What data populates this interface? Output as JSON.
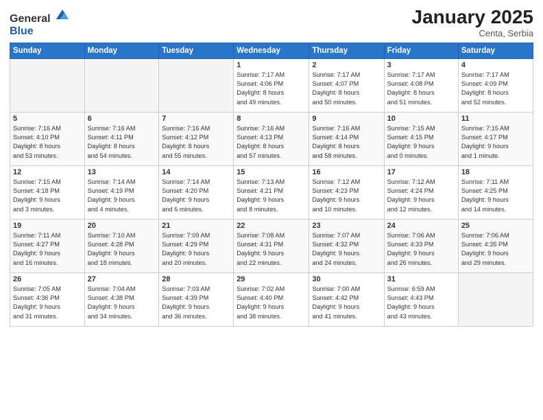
{
  "header": {
    "logo_general": "General",
    "logo_blue": "Blue",
    "month_year": "January 2025",
    "location": "Centa, Serbia"
  },
  "days_of_week": [
    "Sunday",
    "Monday",
    "Tuesday",
    "Wednesday",
    "Thursday",
    "Friday",
    "Saturday"
  ],
  "weeks": [
    [
      {
        "day": "",
        "info": ""
      },
      {
        "day": "",
        "info": ""
      },
      {
        "day": "",
        "info": ""
      },
      {
        "day": "1",
        "info": "Sunrise: 7:17 AM\nSunset: 4:06 PM\nDaylight: 8 hours\nand 49 minutes."
      },
      {
        "day": "2",
        "info": "Sunrise: 7:17 AM\nSunset: 4:07 PM\nDaylight: 8 hours\nand 50 minutes."
      },
      {
        "day": "3",
        "info": "Sunrise: 7:17 AM\nSunset: 4:08 PM\nDaylight: 8 hours\nand 51 minutes."
      },
      {
        "day": "4",
        "info": "Sunrise: 7:17 AM\nSunset: 4:09 PM\nDaylight: 8 hours\nand 52 minutes."
      }
    ],
    [
      {
        "day": "5",
        "info": "Sunrise: 7:16 AM\nSunset: 4:10 PM\nDaylight: 8 hours\nand 53 minutes."
      },
      {
        "day": "6",
        "info": "Sunrise: 7:16 AM\nSunset: 4:11 PM\nDaylight: 8 hours\nand 54 minutes."
      },
      {
        "day": "7",
        "info": "Sunrise: 7:16 AM\nSunset: 4:12 PM\nDaylight: 8 hours\nand 55 minutes."
      },
      {
        "day": "8",
        "info": "Sunrise: 7:16 AM\nSunset: 4:13 PM\nDaylight: 8 hours\nand 57 minutes."
      },
      {
        "day": "9",
        "info": "Sunrise: 7:16 AM\nSunset: 4:14 PM\nDaylight: 8 hours\nand 58 minutes."
      },
      {
        "day": "10",
        "info": "Sunrise: 7:15 AM\nSunset: 4:15 PM\nDaylight: 9 hours\nand 0 minutes."
      },
      {
        "day": "11",
        "info": "Sunrise: 7:15 AM\nSunset: 4:17 PM\nDaylight: 9 hours\nand 1 minute."
      }
    ],
    [
      {
        "day": "12",
        "info": "Sunrise: 7:15 AM\nSunset: 4:18 PM\nDaylight: 9 hours\nand 3 minutes."
      },
      {
        "day": "13",
        "info": "Sunrise: 7:14 AM\nSunset: 4:19 PM\nDaylight: 9 hours\nand 4 minutes."
      },
      {
        "day": "14",
        "info": "Sunrise: 7:14 AM\nSunset: 4:20 PM\nDaylight: 9 hours\nand 6 minutes."
      },
      {
        "day": "15",
        "info": "Sunrise: 7:13 AM\nSunset: 4:21 PM\nDaylight: 9 hours\nand 8 minutes."
      },
      {
        "day": "16",
        "info": "Sunrise: 7:12 AM\nSunset: 4:23 PM\nDaylight: 9 hours\nand 10 minutes."
      },
      {
        "day": "17",
        "info": "Sunrise: 7:12 AM\nSunset: 4:24 PM\nDaylight: 9 hours\nand 12 minutes."
      },
      {
        "day": "18",
        "info": "Sunrise: 7:11 AM\nSunset: 4:25 PM\nDaylight: 9 hours\nand 14 minutes."
      }
    ],
    [
      {
        "day": "19",
        "info": "Sunrise: 7:11 AM\nSunset: 4:27 PM\nDaylight: 9 hours\nand 16 minutes."
      },
      {
        "day": "20",
        "info": "Sunrise: 7:10 AM\nSunset: 4:28 PM\nDaylight: 9 hours\nand 18 minutes."
      },
      {
        "day": "21",
        "info": "Sunrise: 7:09 AM\nSunset: 4:29 PM\nDaylight: 9 hours\nand 20 minutes."
      },
      {
        "day": "22",
        "info": "Sunrise: 7:08 AM\nSunset: 4:31 PM\nDaylight: 9 hours\nand 22 minutes."
      },
      {
        "day": "23",
        "info": "Sunrise: 7:07 AM\nSunset: 4:32 PM\nDaylight: 9 hours\nand 24 minutes."
      },
      {
        "day": "24",
        "info": "Sunrise: 7:06 AM\nSunset: 4:33 PM\nDaylight: 9 hours\nand 26 minutes."
      },
      {
        "day": "25",
        "info": "Sunrise: 7:06 AM\nSunset: 4:35 PM\nDaylight: 9 hours\nand 29 minutes."
      }
    ],
    [
      {
        "day": "26",
        "info": "Sunrise: 7:05 AM\nSunset: 4:36 PM\nDaylight: 9 hours\nand 31 minutes."
      },
      {
        "day": "27",
        "info": "Sunrise: 7:04 AM\nSunset: 4:38 PM\nDaylight: 9 hours\nand 34 minutes."
      },
      {
        "day": "28",
        "info": "Sunrise: 7:03 AM\nSunset: 4:39 PM\nDaylight: 9 hours\nand 36 minutes."
      },
      {
        "day": "29",
        "info": "Sunrise: 7:02 AM\nSunset: 4:40 PM\nDaylight: 9 hours\nand 38 minutes."
      },
      {
        "day": "30",
        "info": "Sunrise: 7:00 AM\nSunset: 4:42 PM\nDaylight: 9 hours\nand 41 minutes."
      },
      {
        "day": "31",
        "info": "Sunrise: 6:59 AM\nSunset: 4:43 PM\nDaylight: 9 hours\nand 43 minutes."
      },
      {
        "day": "",
        "info": ""
      }
    ]
  ]
}
